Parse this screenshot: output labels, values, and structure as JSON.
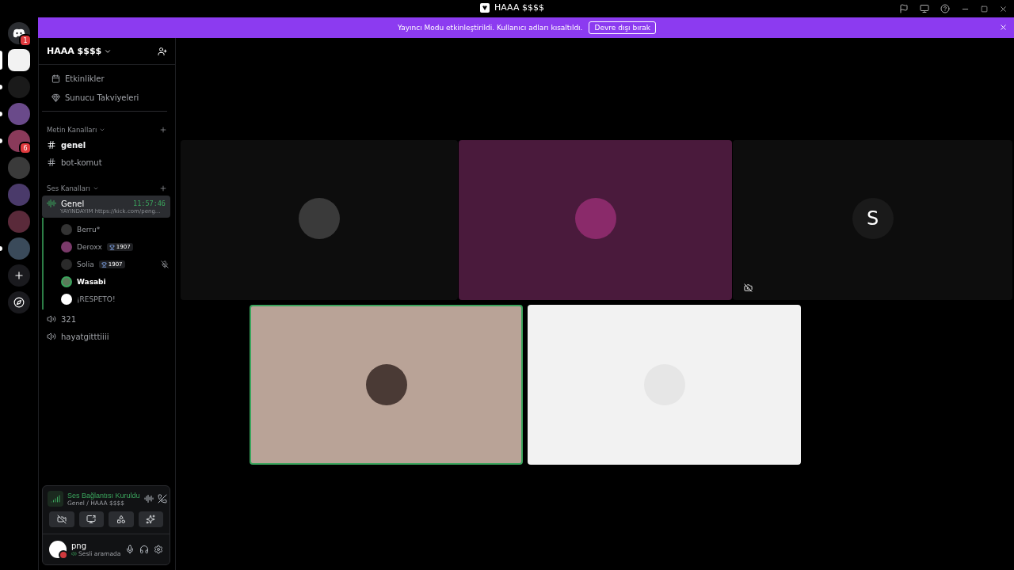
{
  "window": {
    "title": "HAAA $$$$"
  },
  "banner": {
    "text": "Yayıncı Modu etkinleştirildi. Kullanıcı adları kısaltıldı.",
    "button": "Devre dışı bırak"
  },
  "servers": [
    {
      "kind": "home",
      "badge": "1",
      "selected": false,
      "unread": false,
      "color": "#2b2d31"
    },
    {
      "kind": "server",
      "selected": true,
      "unread": false,
      "color": "#f2f2f2"
    },
    {
      "kind": "server",
      "selected": false,
      "unread": true,
      "color": "#1a1a1a"
    },
    {
      "kind": "server",
      "selected": false,
      "unread": true,
      "color": "#6a4a8a"
    },
    {
      "kind": "server",
      "badge": "6",
      "selected": false,
      "unread": true,
      "color": "#8a3a5a"
    },
    {
      "kind": "server",
      "selected": false,
      "unread": false,
      "color": "#3a3a3a"
    },
    {
      "kind": "server",
      "selected": false,
      "unread": false,
      "color": "#4a3a6a"
    },
    {
      "kind": "server",
      "selected": false,
      "unread": false,
      "color": "#5a2a3a"
    },
    {
      "kind": "server",
      "selected": false,
      "unread": true,
      "color": "#3a4a5a"
    },
    {
      "kind": "add",
      "selected": false,
      "unread": false,
      "color": "#1a1a1e"
    },
    {
      "kind": "discover",
      "selected": false,
      "unread": false,
      "color": "#1a1a1e"
    }
  ],
  "server_name": "HAAA $$$$",
  "top_items": [
    {
      "kind": "events",
      "label": "Etkinlikler"
    },
    {
      "kind": "boosts",
      "label": "Sunucu Takviyeleri"
    }
  ],
  "categories": [
    {
      "name": "Metin Kanalları",
      "channels": [
        {
          "kind": "text",
          "name": "genel",
          "selected": false,
          "unread": true
        },
        {
          "kind": "text",
          "name": "bot-komut",
          "selected": false,
          "unread": false
        }
      ]
    },
    {
      "name": "Ses Kanalları",
      "channels": [
        {
          "kind": "voice",
          "name": "Genel",
          "selected": true,
          "unread": false,
          "time": "11:57:46",
          "status": "YAYINDAYIM https://kick.com/peng...",
          "users": [
            {
              "name": "Berru*",
              "speaking": false,
              "muted": false
            },
            {
              "name": "Deroxx",
              "badge": "1907",
              "speaking": false,
              "muted": false
            },
            {
              "name": "Solia",
              "badge": "1907",
              "speaking": false,
              "muted": true
            },
            {
              "name": "Wasabi",
              "speaking": true,
              "muted": false
            },
            {
              "name": "¡RESPETO!",
              "speaking": false,
              "muted": false
            }
          ]
        },
        {
          "kind": "voice",
          "name": "321",
          "selected": false,
          "unread": false
        },
        {
          "kind": "voice",
          "name": "hayatgitttiiii",
          "selected": false,
          "unread": false
        }
      ]
    }
  ],
  "voice_panel": {
    "status": "Ses Bağlantısı Kuruldu",
    "location": "Genel / HAAA $$$$"
  },
  "user": {
    "name": "png",
    "status": "Sesli aramada"
  },
  "tiles_top": [
    {
      "color": "#0d0d0d",
      "speaking": false,
      "camera_off": false
    },
    {
      "color": "#4a1a3c",
      "speaking": false,
      "camera_off": false
    },
    {
      "color": "#0d0d0d",
      "speaking": false,
      "letter": "S",
      "camera_off": true
    }
  ],
  "tiles_bottom": [
    {
      "color": "#b9a397",
      "speaking": true,
      "camera_off": false
    },
    {
      "color": "#f2f2f2",
      "speaking": false,
      "camera_off": false
    }
  ]
}
